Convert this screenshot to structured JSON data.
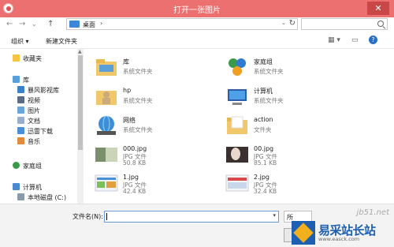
{
  "window": {
    "title": "打开一张图片",
    "close_label": "✕"
  },
  "nav": {
    "back": "←",
    "forward": "→",
    "history": "⌄",
    "up": "↑"
  },
  "address": {
    "location": "桌面",
    "chevron": "›",
    "dropdown": "⌄",
    "refresh": "↻"
  },
  "toolbar": {
    "organize": "组织 ▾",
    "new_folder": "新建文件夹",
    "view_icon": "▦ ▾",
    "pane_icon": "▭",
    "help_icon": "?"
  },
  "sidebar": {
    "favorites": "收藏夹",
    "libraries": "库",
    "lib_items": [
      "暴风影视库",
      "视频",
      "图片",
      "文档",
      "迅雷下载",
      "音乐"
    ],
    "homegroup": "家庭组",
    "computer": "计算机",
    "drive": "本地磁盘 (C:)"
  },
  "files": [
    {
      "name": "库",
      "meta1": "系统文件夹",
      "meta2": ""
    },
    {
      "name": "家庭组",
      "meta1": "系统文件夹",
      "meta2": ""
    },
    {
      "name": "hp",
      "meta1": "系统文件夹",
      "meta2": ""
    },
    {
      "name": "计算机",
      "meta1": "系统文件夹",
      "meta2": ""
    },
    {
      "name": "网络",
      "meta1": "系统文件夹",
      "meta2": ""
    },
    {
      "name": "action",
      "meta1": "文件夹",
      "meta2": ""
    },
    {
      "name": "000.jpg",
      "meta1": "JPG 文件",
      "meta2": "50.8 KB"
    },
    {
      "name": "00.jpg",
      "meta1": "JPG 文件",
      "meta2": "85.1 KB"
    },
    {
      "name": "1.jpg",
      "meta1": "JPG 文件",
      "meta2": "42.4 KB"
    },
    {
      "name": "2.jpg",
      "meta1": "JPG 文件",
      "meta2": "32.4 KB"
    }
  ],
  "bottom": {
    "filename_label": "文件名(N):",
    "filename_value": "",
    "filetype_value": "所"
  },
  "watermark": {
    "top": "jb51.net",
    "brand": "易采站长站",
    "sub": "www.easck.com"
  }
}
